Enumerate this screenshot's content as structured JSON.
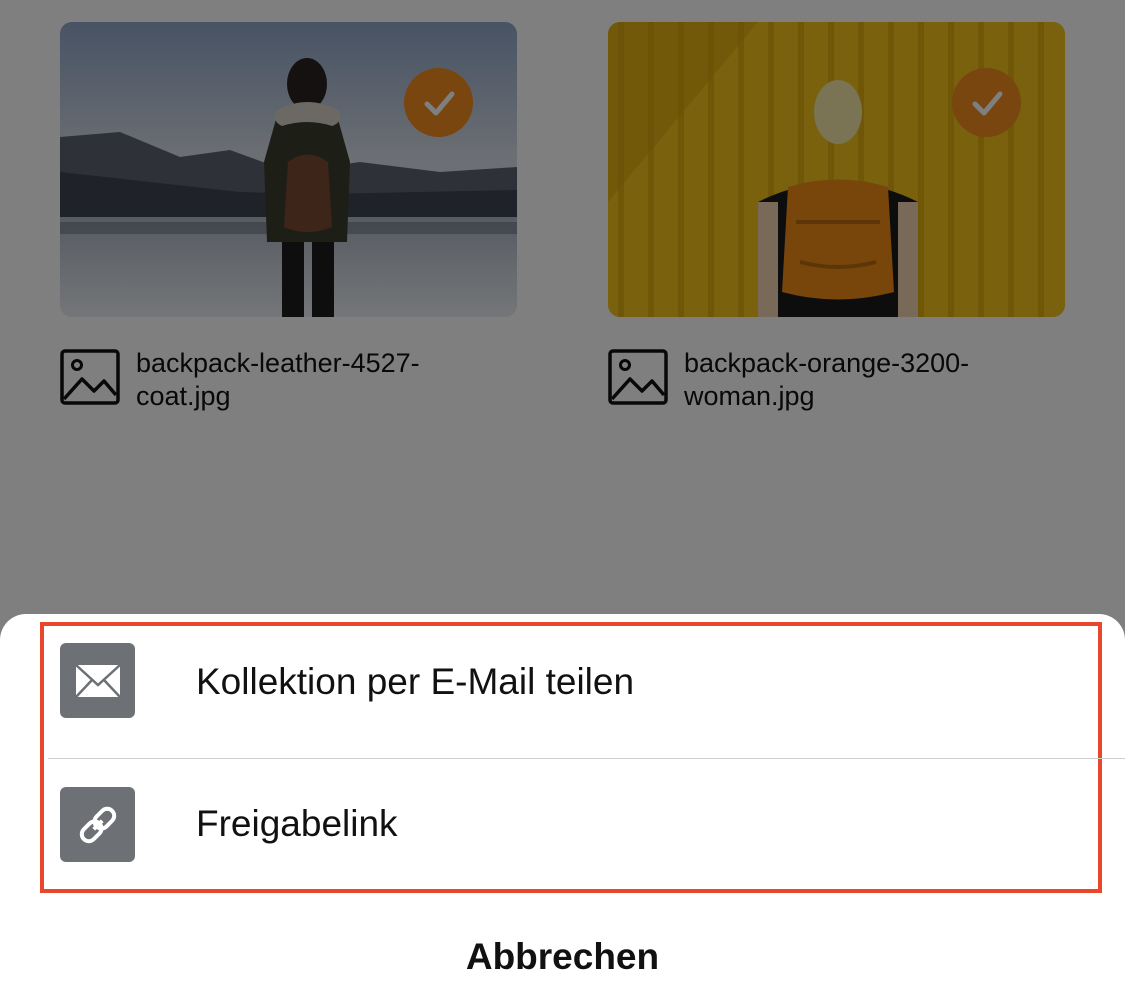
{
  "colors": {
    "accent": "#f08c1d",
    "highlight": "#e8472c",
    "icon_bg": "#6d7175"
  },
  "files": [
    {
      "name": "backpack-leather-4527-coat.jpg",
      "selected": true,
      "icon": "image-file-icon"
    },
    {
      "name": "backpack-orange-3200-woman.jpg",
      "selected": true,
      "icon": "image-file-icon"
    }
  ],
  "share_sheet": {
    "email_label": "Kollektion per E-Mail teilen",
    "email_icon": "envelope-icon",
    "link_label": "Freigabelink",
    "link_icon": "link-icon",
    "cancel_label": "Abbrechen"
  }
}
